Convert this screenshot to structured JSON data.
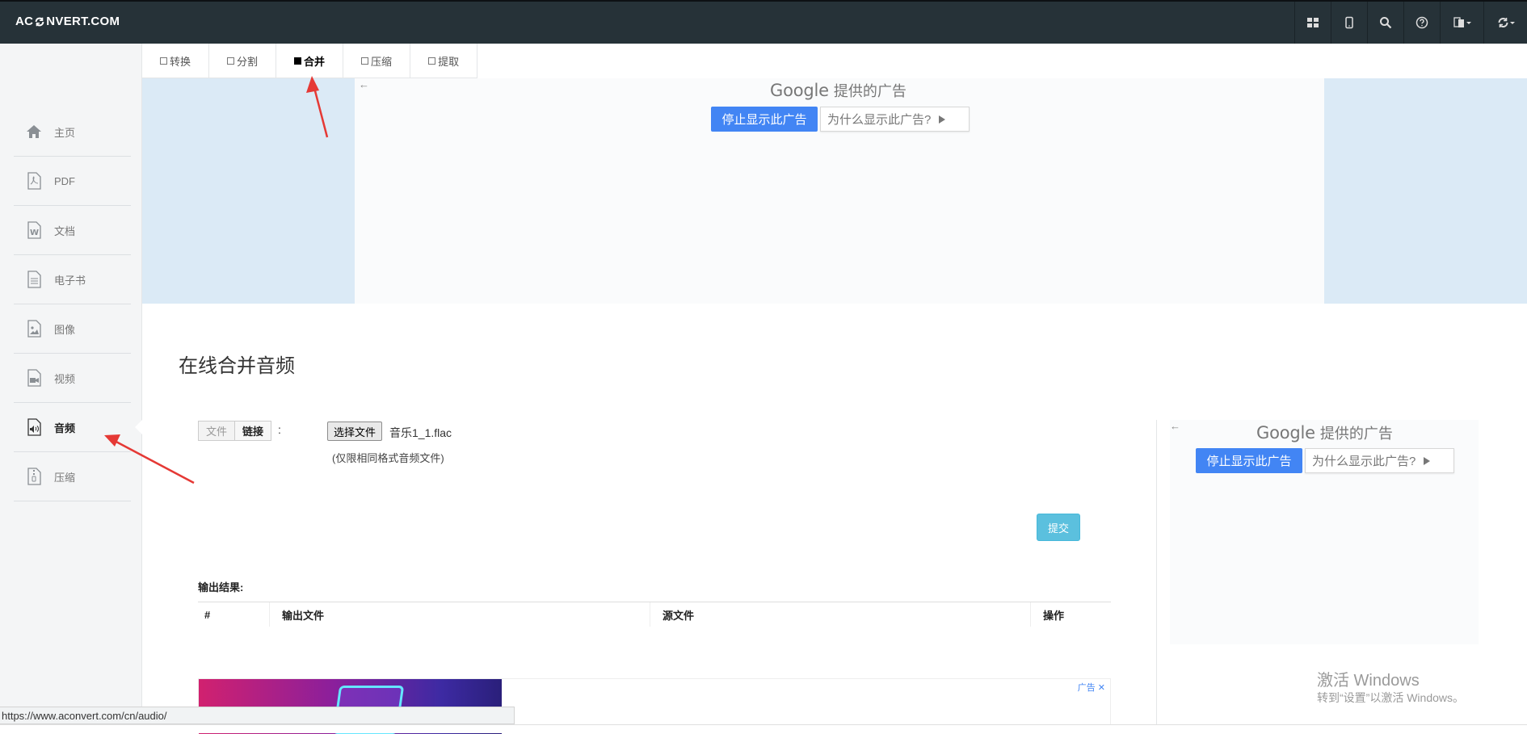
{
  "brand": {
    "text_left": "AC",
    "text_right": "NVERT.COM"
  },
  "navbar": {
    "icons": [
      "grid-icon",
      "tablet-icon",
      "search-icon",
      "help-icon",
      "language-icon",
      "refresh-icon"
    ]
  },
  "sidebar": {
    "items": [
      {
        "label": "主页",
        "icon": "home-icon"
      },
      {
        "label": "PDF",
        "icon": "pdf-icon"
      },
      {
        "label": "文档",
        "icon": "word-document-icon"
      },
      {
        "label": "电子书",
        "icon": "ebook-icon"
      },
      {
        "label": "图像",
        "icon": "image-icon"
      },
      {
        "label": "视频",
        "icon": "video-icon"
      },
      {
        "label": "音频",
        "icon": "audio-icon"
      },
      {
        "label": "压缩",
        "icon": "archive-icon"
      }
    ],
    "active_index": 6
  },
  "tabs": [
    {
      "label": "转换"
    },
    {
      "label": "分割"
    },
    {
      "label": "合并"
    },
    {
      "label": "压缩"
    },
    {
      "label": "提取"
    }
  ],
  "active_tab": 2,
  "ads": {
    "back_arrow": "←",
    "google_word": "Google",
    "provided": "提供的广告",
    "stop_label": "停止显示此广告",
    "why_label": "为什么显示此广告?",
    "ad_label": "广告",
    "close": "✕"
  },
  "page": {
    "title": "在线合并音频"
  },
  "form": {
    "source_file": "文件",
    "source_link": "链接",
    "colon": ":",
    "choose_file": "选择文件",
    "file_name": "音乐1_1.flac",
    "hint": "(仅限相同格式音频文件)",
    "submit": "提交"
  },
  "output": {
    "title": "输出结果:",
    "headers": [
      "#",
      "输出文件",
      "源文件",
      "操作"
    ]
  },
  "watermark": {
    "line1": "激活 Windows",
    "line2": "转到“设置”以激活 Windows。"
  },
  "status_bar": {
    "url": "https://www.aconvert.com/cn/audio/"
  },
  "colors": {
    "navbar": "#263238",
    "sidebar": "#f4f5f6",
    "ad_blue": "#4285f4",
    "submit": "#5bc0de",
    "arrow": "#e53935"
  }
}
